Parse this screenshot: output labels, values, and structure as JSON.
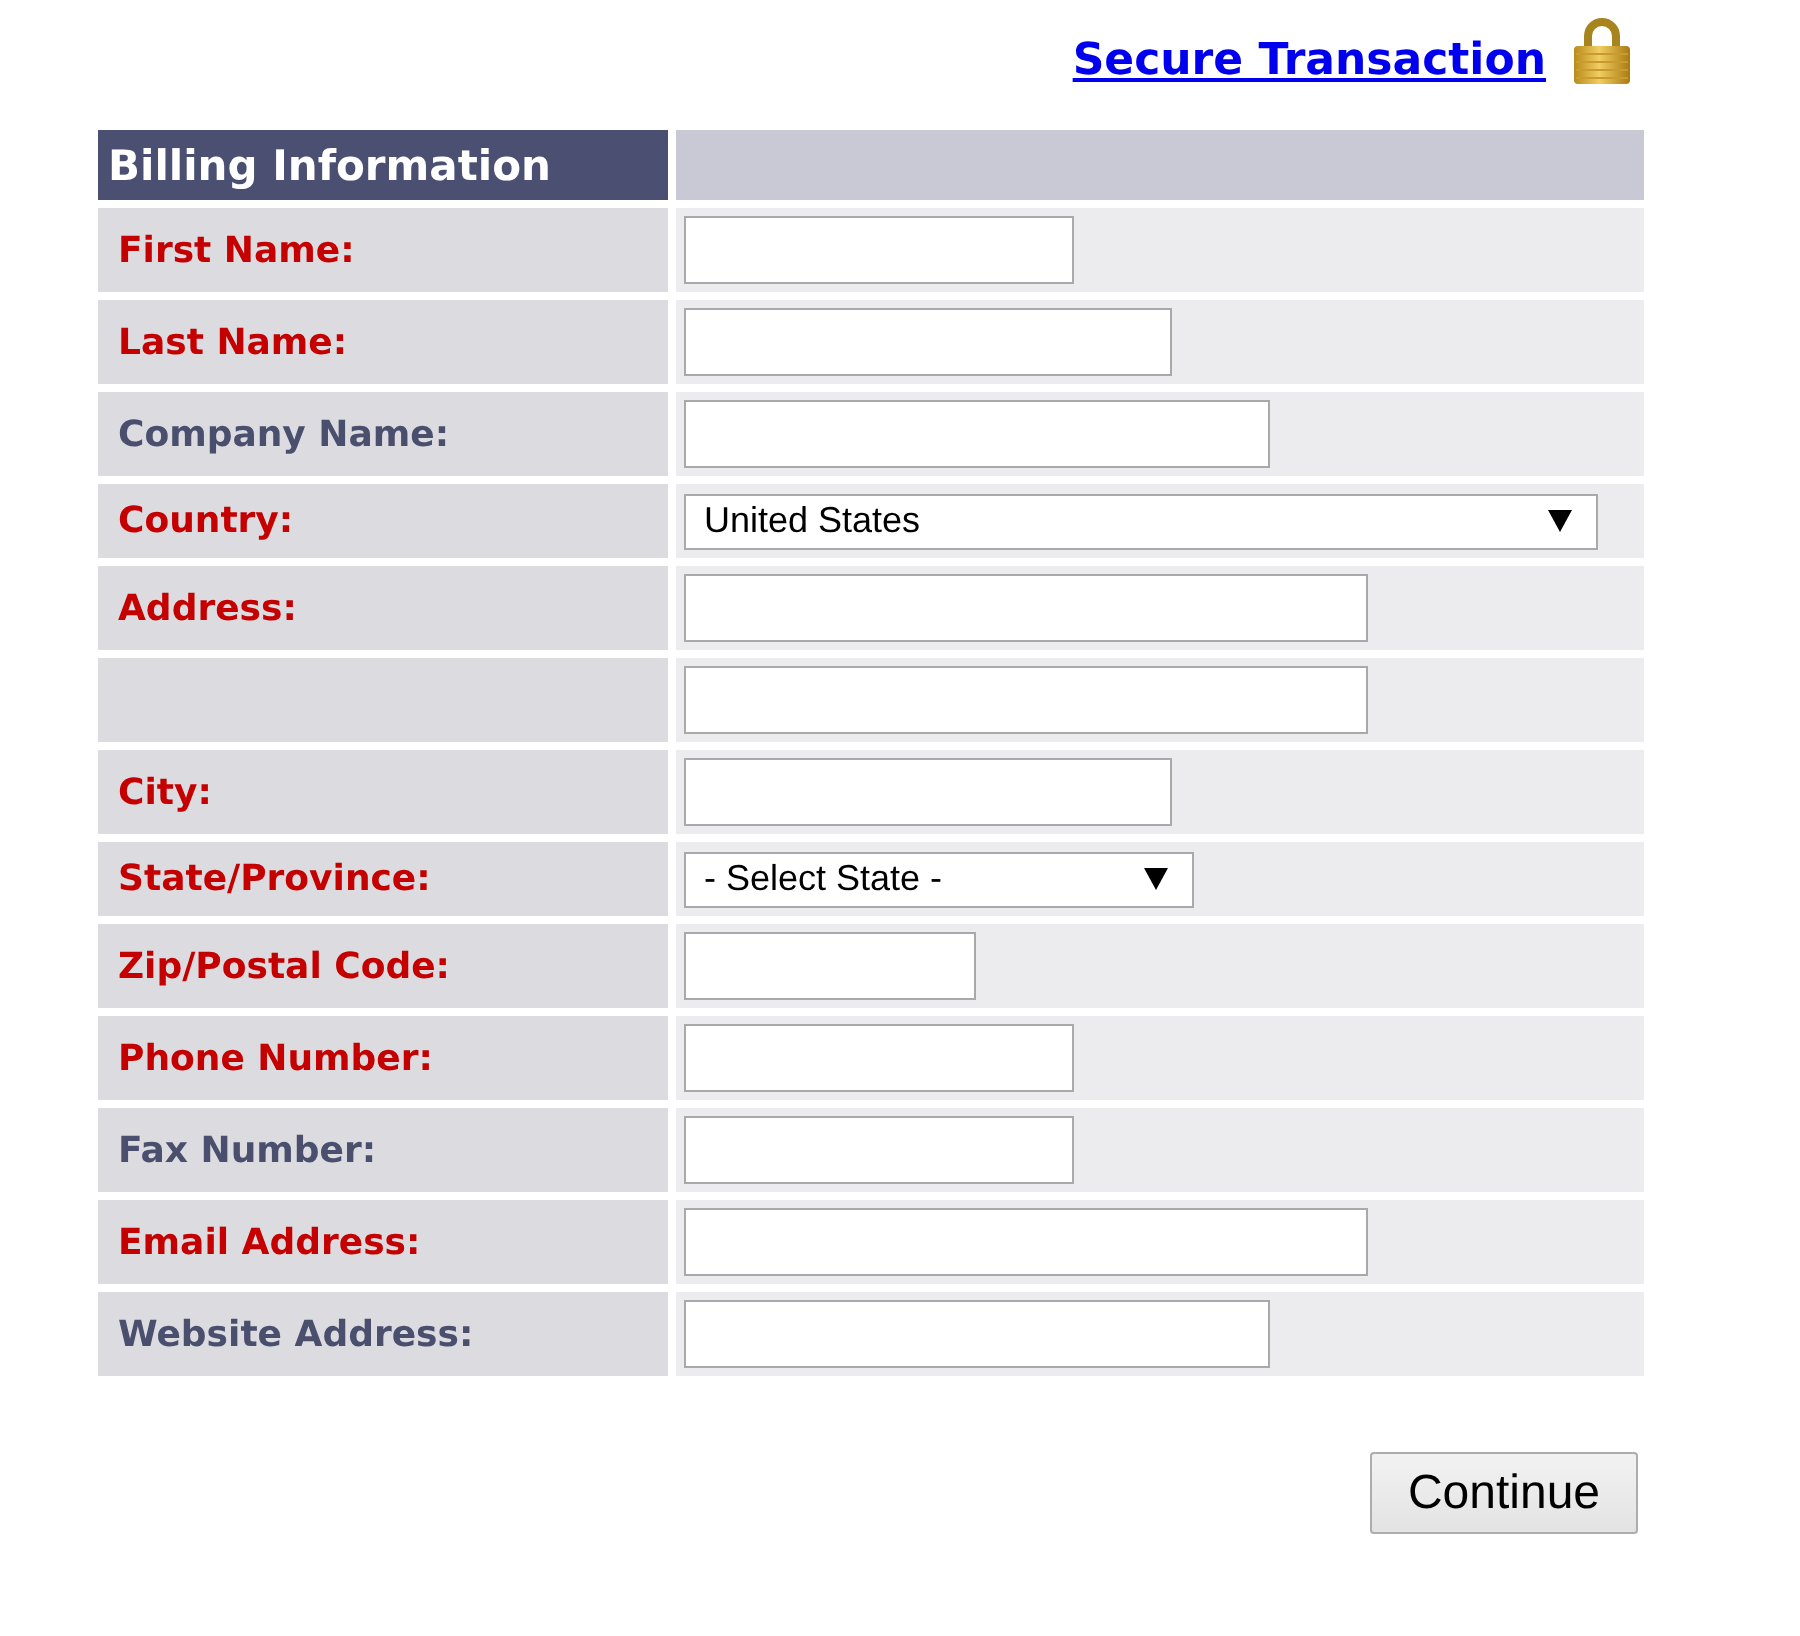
{
  "header": {
    "link": "Secure Transaction"
  },
  "form": {
    "title": "Billing Information",
    "rows": [
      {
        "label": "First Name:",
        "required": true,
        "kind": "text"
      },
      {
        "label": "Last Name:",
        "required": true,
        "kind": "text"
      },
      {
        "label": "Company Name:",
        "required": false,
        "kind": "text"
      },
      {
        "label": "Country:",
        "required": true,
        "kind": "select",
        "value": "United States"
      },
      {
        "label": "Address:",
        "required": true,
        "kind": "text"
      },
      {
        "kind": "text"
      },
      {
        "label": "City:",
        "required": true,
        "kind": "text"
      },
      {
        "label": "State/Province:",
        "required": true,
        "kind": "select",
        "value": "- Select State -"
      },
      {
        "label": "Zip/Postal Code:",
        "required": true,
        "kind": "text"
      },
      {
        "label": "Phone Number:",
        "required": true,
        "kind": "text"
      },
      {
        "label": "Fax Number:",
        "required": false,
        "kind": "text"
      },
      {
        "label": "Email Address:",
        "required": true,
        "kind": "text"
      },
      {
        "label": "Website Address:",
        "required": false,
        "kind": "text"
      }
    ],
    "button": "Continue"
  }
}
